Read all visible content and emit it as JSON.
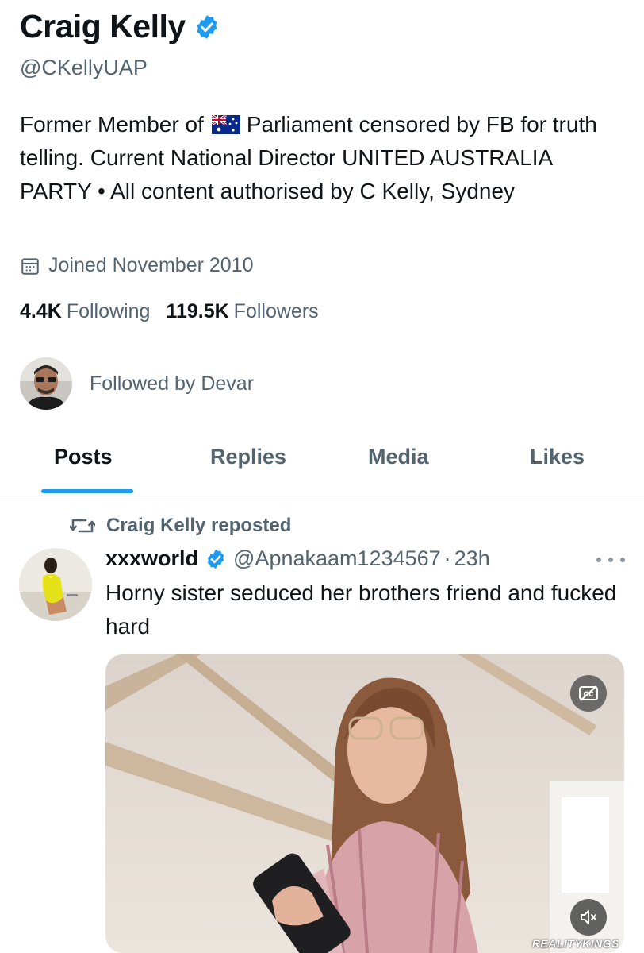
{
  "profile": {
    "display_name": "Craig Kelly",
    "handle": "@CKellyUAP",
    "bio_before_flag": "Former Member of",
    "bio_flag_icon": "australia-flag-icon",
    "bio_after_flag": "Parliament censored by FB for truth telling. Current National Director UNITED AUSTRALIA PARTY • All content authorised by C Kelly, Sydney",
    "joined": "Joined November 2010",
    "following_count": "4.4K",
    "following_label": "Following",
    "followers_count": "119.5K",
    "followers_label": "Followers",
    "followed_by": "Followed by Devar"
  },
  "tabs": [
    {
      "label": "Posts",
      "active": true
    },
    {
      "label": "Replies",
      "active": false
    },
    {
      "label": "Media",
      "active": false
    },
    {
      "label": "Likes",
      "active": false
    }
  ],
  "post": {
    "repost_label": "Craig Kelly reposted",
    "author_name": "xxxworld",
    "author_handle": "@Apnakaam1234567",
    "separator": "·",
    "time": "23h",
    "text": "Horny sister seduced her brothers friend and fucked hard",
    "media": {
      "watermark": "REALITYKINGS",
      "caption_icon": "closed-captions-off-icon",
      "mute_icon": "volume-muted-icon"
    }
  },
  "colors": {
    "accent": "#1d9bf0",
    "text_primary": "#0f1419",
    "text_secondary": "#536471",
    "verified": "#1d9bf0"
  }
}
